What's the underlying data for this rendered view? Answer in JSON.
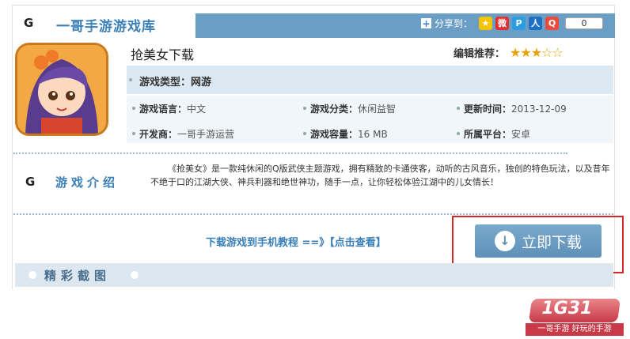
{
  "header": {
    "g_mark": "G",
    "title": "一哥手游游戏库",
    "share_label": "分享到：",
    "share_plus": "+",
    "share_count": "0",
    "share_buttons": [
      "qzone-icon",
      "weibo-icon",
      "pengyou-icon",
      "renren-icon",
      "tencent-weibo-icon"
    ]
  },
  "game": {
    "name": "抢美女下载",
    "rec_label": "编辑推荐：",
    "rating": 3,
    "rating_max": 5,
    "type_label": "游戏类型：",
    "type_value": "网游",
    "info": [
      {
        "k": "游戏语言：",
        "v": "中文"
      },
      {
        "k": "游戏分类：",
        "v": "休闲益智"
      },
      {
        "k": "更新时间：",
        "v": "2013-12-09"
      },
      {
        "k": "开发商：",
        "v": "一哥手游运营"
      },
      {
        "k": "游戏容量：",
        "v": "16 MB"
      },
      {
        "k": "所属平台：",
        "v": "安卓"
      }
    ]
  },
  "intro": {
    "g_mark": "G",
    "label": "游戏介绍",
    "text": "《抢美女》是一款纯休闲的Q版武侠主题游戏，拥有精致的卡通侠客，动听的古风音乐，独创的特色玩法，以及昔年不绝于口的江湖大侠、神兵利器和绝世神功，随手一点，让你轻松体验江湖中的儿女情长！"
  },
  "download": {
    "tutorial": "下载游戏到手机教程 ==》【点击查看】",
    "button": "立即下载",
    "arrow": "↓"
  },
  "screenshots": {
    "label": "精彩截图"
  },
  "watermark": {
    "logo": "1G31",
    "slogan": "一哥手游 好玩的手游"
  },
  "colors": {
    "accent": "#6a9ec4",
    "highlight": "#d8262a",
    "star": "#e8a100"
  }
}
